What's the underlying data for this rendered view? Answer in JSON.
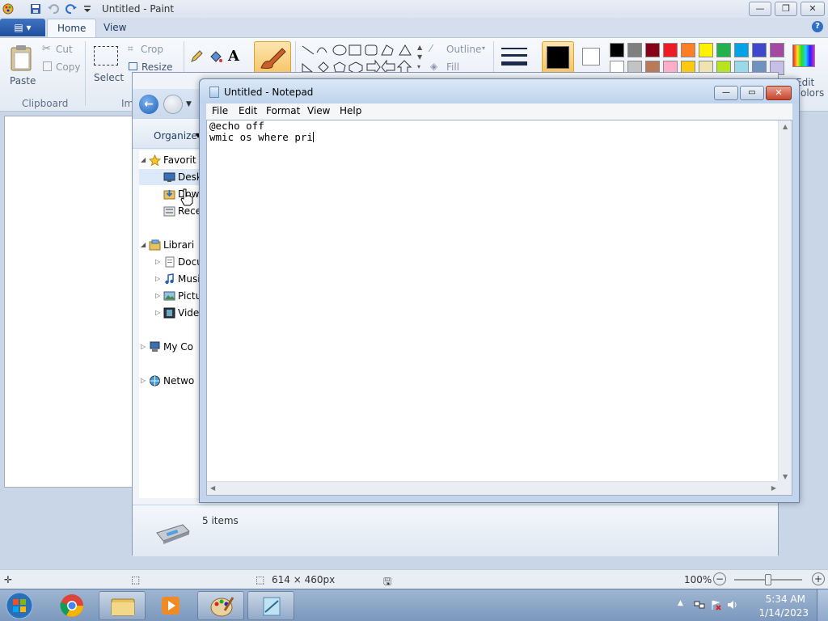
{
  "paint": {
    "title": "Untitled - Paint",
    "app_menu_icon": "app-menu-icon",
    "tabs": [
      {
        "label": "Home",
        "active": true
      },
      {
        "label": "View",
        "active": false
      }
    ],
    "clipboard": {
      "paste": "Paste",
      "cut": "Cut",
      "copy": "Copy",
      "group": "Clipboard"
    },
    "image": {
      "select": "Select",
      "crop": "Crop",
      "resize": "Resize",
      "group": "Im"
    },
    "shapes": {
      "outline": "Outline",
      "fill": "Fill"
    },
    "colors": {
      "color1": "#000000",
      "color2": "#ffffff",
      "row1": [
        "#000000",
        "#7f7f7f",
        "#880015",
        "#ed1c24",
        "#ff7f27",
        "#fff200",
        "#22b14c",
        "#00a2e8",
        "#3f48cc",
        "#a349a4"
      ],
      "row2": [
        "#ffffff",
        "#c3c3c3",
        "#b97a57",
        "#ffaec9",
        "#ffc90e",
        "#efe4b0",
        "#b5e61d",
        "#99d9ea",
        "#7092be",
        "#c8bfe7"
      ],
      "edit_label_line1": "Edit",
      "edit_label_line2": "olors"
    },
    "status": {
      "canvas_size": "614 × 460px",
      "zoom": "100%"
    }
  },
  "explorer": {
    "organize": "Organize",
    "tree": [
      {
        "label": "Favorit",
        "icon": "star-icon",
        "expander": "◢"
      },
      {
        "label": "Desk",
        "icon": "desktop-icon",
        "expander": ""
      },
      {
        "label": "Dow",
        "icon": "downloads-icon",
        "expander": ""
      },
      {
        "label": "Rece",
        "icon": "recent-icon",
        "expander": ""
      },
      {
        "label": "Librari",
        "icon": "libraries-icon",
        "expander": "◢"
      },
      {
        "label": "Docu",
        "icon": "documents-icon",
        "expander": "▷"
      },
      {
        "label": "Musi",
        "icon": "music-icon",
        "expander": "▷"
      },
      {
        "label": "Pictu",
        "icon": "pictures-icon",
        "expander": "▷"
      },
      {
        "label": "Vide",
        "icon": "videos-icon",
        "expander": "▷"
      },
      {
        "label": "My Co",
        "icon": "computer-icon",
        "expander": "▷"
      },
      {
        "label": "Netwo",
        "icon": "network-icon",
        "expander": "▷"
      }
    ],
    "details": "5 items"
  },
  "notepad": {
    "title": "Untitled - Notepad",
    "menu": [
      "File",
      "Edit",
      "Format",
      "View",
      "Help"
    ],
    "content": "@echo off\nwmic os where pri"
  },
  "taskbar": {
    "apps": [
      "chrome-icon",
      "explorer-icon",
      "media-player-icon",
      "paint-icon",
      "notepad-icon"
    ],
    "time": "5:34 AM",
    "date": "1/14/2023"
  }
}
